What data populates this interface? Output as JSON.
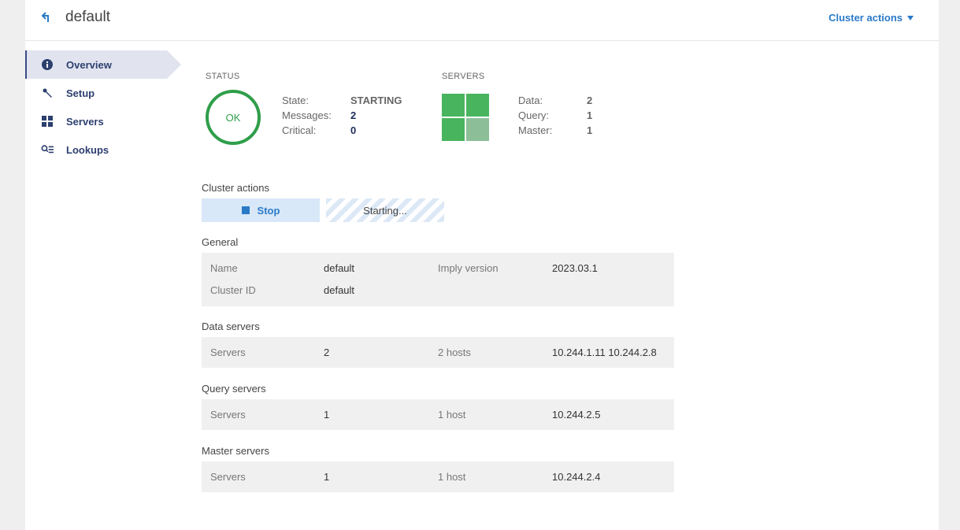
{
  "header": {
    "title": "default",
    "cluster_actions_label": "Cluster actions"
  },
  "sidebar": {
    "items": [
      {
        "label": "Overview",
        "icon": "info-icon",
        "active": true
      },
      {
        "label": "Setup",
        "icon": "wrench-icon",
        "active": false
      },
      {
        "label": "Servers",
        "icon": "grid-icon",
        "active": false
      },
      {
        "label": "Lookups",
        "icon": "lookup-icon",
        "active": false
      }
    ]
  },
  "status": {
    "heading": "STATUS",
    "indicator": "OK",
    "fields": [
      {
        "key": "State:",
        "value": "STARTING"
      },
      {
        "key": "Messages:",
        "value": "2"
      },
      {
        "key": "Critical:",
        "value": "0"
      }
    ]
  },
  "servers": {
    "heading": "SERVERS",
    "fields": [
      {
        "key": "Data:",
        "value": "2"
      },
      {
        "key": "Query:",
        "value": "1"
      },
      {
        "key": "Master:",
        "value": "1"
      }
    ]
  },
  "actions": {
    "heading": "Cluster actions",
    "stop_label": "Stop",
    "starting_label": "Starting..."
  },
  "general": {
    "heading": "General",
    "name_label": "Name",
    "name_value": "default",
    "version_label": "Imply version",
    "version_value": "2023.03.1",
    "cluster_id_label": "Cluster ID",
    "cluster_id_value": "default"
  },
  "data_servers": {
    "heading": "Data servers",
    "servers_label": "Servers",
    "count": "2",
    "hosts_label": "2 hosts",
    "addresses": "10.244.1.11 10.244.2.8"
  },
  "query_servers": {
    "heading": "Query servers",
    "servers_label": "Servers",
    "count": "1",
    "hosts_label": "1 host",
    "addresses": "10.244.2.5"
  },
  "master_servers": {
    "heading": "Master servers",
    "servers_label": "Servers",
    "count": "1",
    "hosts_label": "1 host",
    "addresses": "10.244.2.4"
  },
  "colors": {
    "accent": "#2a7ac8",
    "ok": "#2f9e4a",
    "nav": "#2d3f6f"
  }
}
